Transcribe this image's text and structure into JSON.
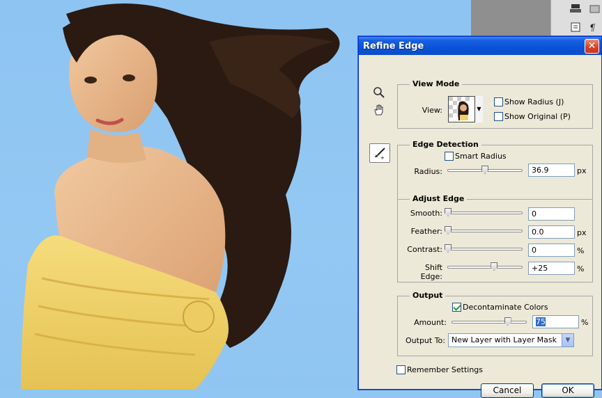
{
  "dialog": {
    "title": "Refine Edge",
    "close_glyph": "✕",
    "tools": [
      "zoom-icon",
      "hand-icon",
      "refine-radius-brush-icon"
    ]
  },
  "view_mode": {
    "title": "View Mode",
    "view_label": "View:",
    "show_radius_label": "Show Radius (J)",
    "show_radius_checked": false,
    "show_original_label": "Show Original (P)",
    "show_original_checked": false
  },
  "edge_detection": {
    "title": "Edge Detection",
    "smart_radius_label": "Smart Radius",
    "smart_radius_checked": false,
    "radius_label": "Radius:",
    "radius_value": "36.9",
    "radius_unit": "px",
    "radius_fraction": 0.5
  },
  "adjust_edge": {
    "title": "Adjust Edge",
    "smooth_label": "Smooth:",
    "smooth_value": "0",
    "smooth_fraction": 0,
    "feather_label": "Feather:",
    "feather_value": "0.0",
    "feather_unit": "px",
    "feather_fraction": 0,
    "contrast_label": "Contrast:",
    "contrast_value": "0",
    "contrast_unit": "%",
    "contrast_fraction": 0,
    "shift_label": "Shift Edge:",
    "shift_value": "+25",
    "shift_unit": "%",
    "shift_fraction": 0.625
  },
  "output": {
    "title": "Output",
    "decontaminate_label": "Decontaminate Colors",
    "decontaminate_checked": true,
    "amount_label": "Amount:",
    "amount_value": "75",
    "amount_unit": "%",
    "amount_fraction": 0.75,
    "output_to_label": "Output To:",
    "output_to_value": "New Layer with Layer Mask"
  },
  "remember_label": "Remember Settings",
  "remember_checked": false,
  "buttons": {
    "cancel": "Cancel",
    "ok": "OK"
  },
  "colors": {
    "canvas_bg": "#8fc6f2",
    "titlebar": "#0a52d6",
    "dialog_bg": "#ece9d8"
  }
}
